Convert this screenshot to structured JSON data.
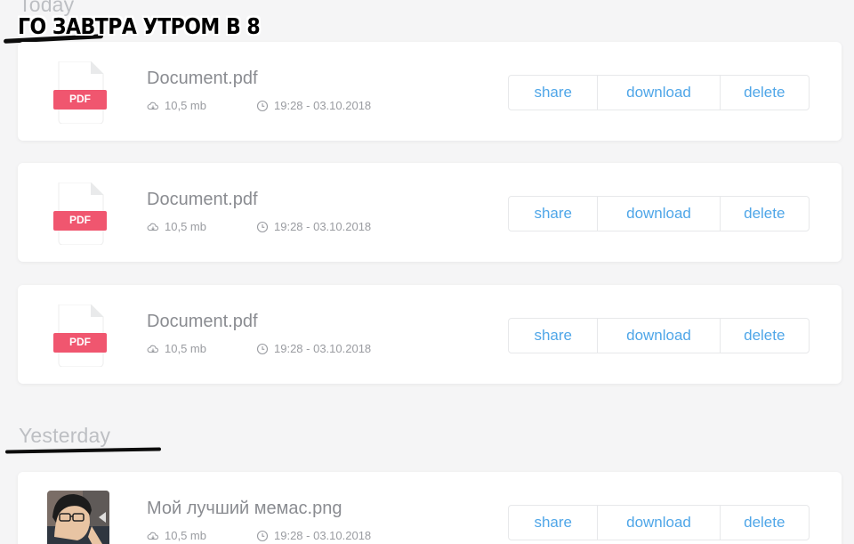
{
  "meme_caption": "ГО ЗАВТРА УТРОМ В 8",
  "sections": {
    "today": "Today",
    "yesterday": "Yesterday"
  },
  "files": [
    {
      "name": "Document.pdf",
      "size": "10,5 mb",
      "datetime": "19:28 - 03.10.2018",
      "badge": "PDF",
      "icon": "pdf-file-icon"
    },
    {
      "name": "Document.pdf",
      "size": "10,5 mb",
      "datetime": "19:28 - 03.10.2018",
      "badge": "PDF",
      "icon": "pdf-file-icon"
    },
    {
      "name": "Document.pdf",
      "size": "10,5 mb",
      "datetime": "19:28 - 03.10.2018",
      "badge": "PDF",
      "icon": "pdf-file-icon"
    },
    {
      "name": "Мой лучший мемас.png",
      "size": "10,5 mb",
      "datetime": "19:28 - 03.10.2018",
      "icon": "image-thumbnail"
    }
  ],
  "actions": {
    "share": "share",
    "download": "download",
    "delete": "delete"
  },
  "colors": {
    "accent": "#4fa6e8",
    "pdf_badge": "#f0566f",
    "background": "#f5f5f6"
  }
}
